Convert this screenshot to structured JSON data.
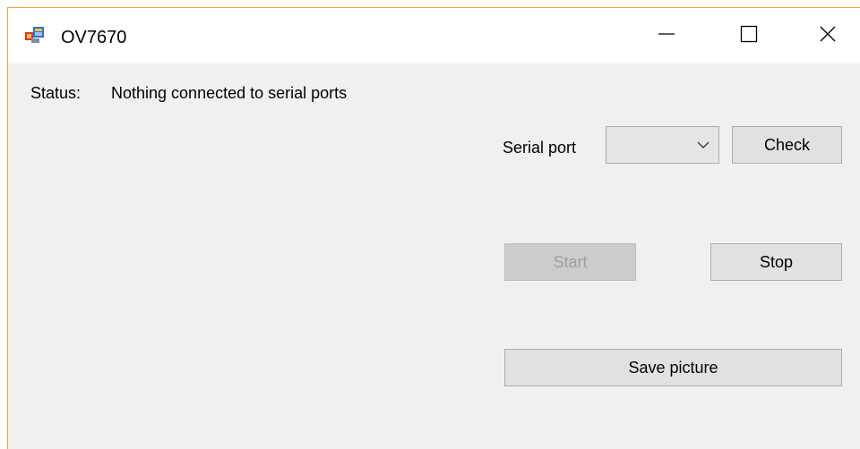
{
  "window": {
    "title": "OV7670",
    "icon": "app-window-icon",
    "controls": {
      "minimize_icon": "minimize-icon",
      "maximize_icon": "maximize-icon",
      "close_icon": "close-icon"
    }
  },
  "status": {
    "label": "Status:",
    "value": "Nothing connected to serial ports"
  },
  "serial": {
    "label": "Serial port",
    "selected": "",
    "dropdown_icon": "chevron-down-icon"
  },
  "buttons": {
    "check": "Check",
    "start": "Start",
    "start_enabled": false,
    "stop": "Stop",
    "save_picture": "Save picture"
  },
  "colors": {
    "window_bg": "#f0f0f0",
    "titlebar_bg": "#ffffff",
    "accent_border": "#e8a64a",
    "button_bg": "#e1e1e1",
    "disabled_button_bg": "#cccccc",
    "disabled_text": "#a0a0a0"
  }
}
